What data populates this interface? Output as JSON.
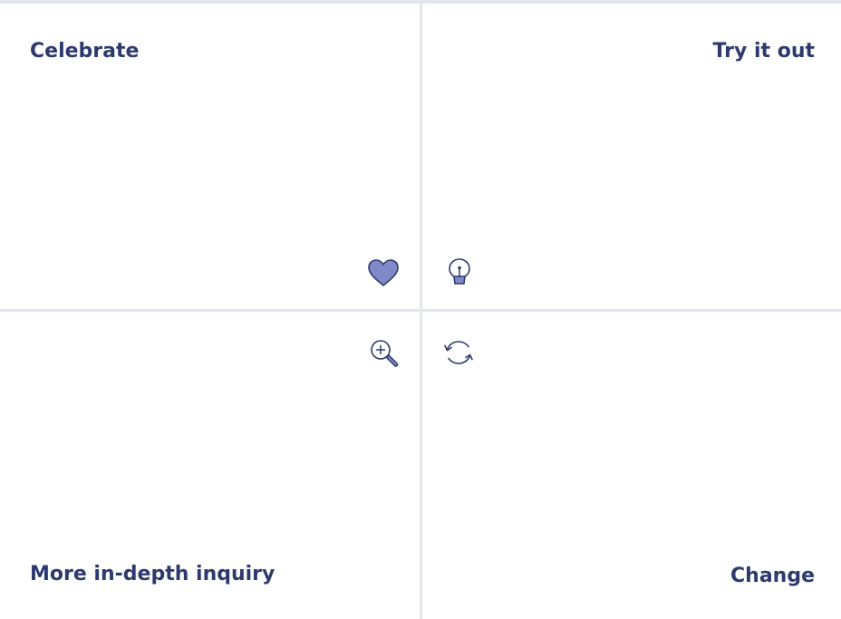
{
  "board": {
    "quadrants": {
      "celebrate": {
        "title": "Celebrate",
        "icon": "heart-icon"
      },
      "try_it_out": {
        "title": "Try it out",
        "icon": "lightbulb-icon"
      },
      "inquiry": {
        "title": "More in-depth inquiry",
        "icon": "zoom-in-icon"
      },
      "change": {
        "title": "Change",
        "icon": "refresh-icon"
      }
    }
  },
  "colors": {
    "title_text": "#2e3a6e",
    "icon_stroke": "#2e3a6e",
    "icon_fill": "#7f89c8",
    "divider": "#e4e6ee",
    "background": "#ffffff"
  }
}
